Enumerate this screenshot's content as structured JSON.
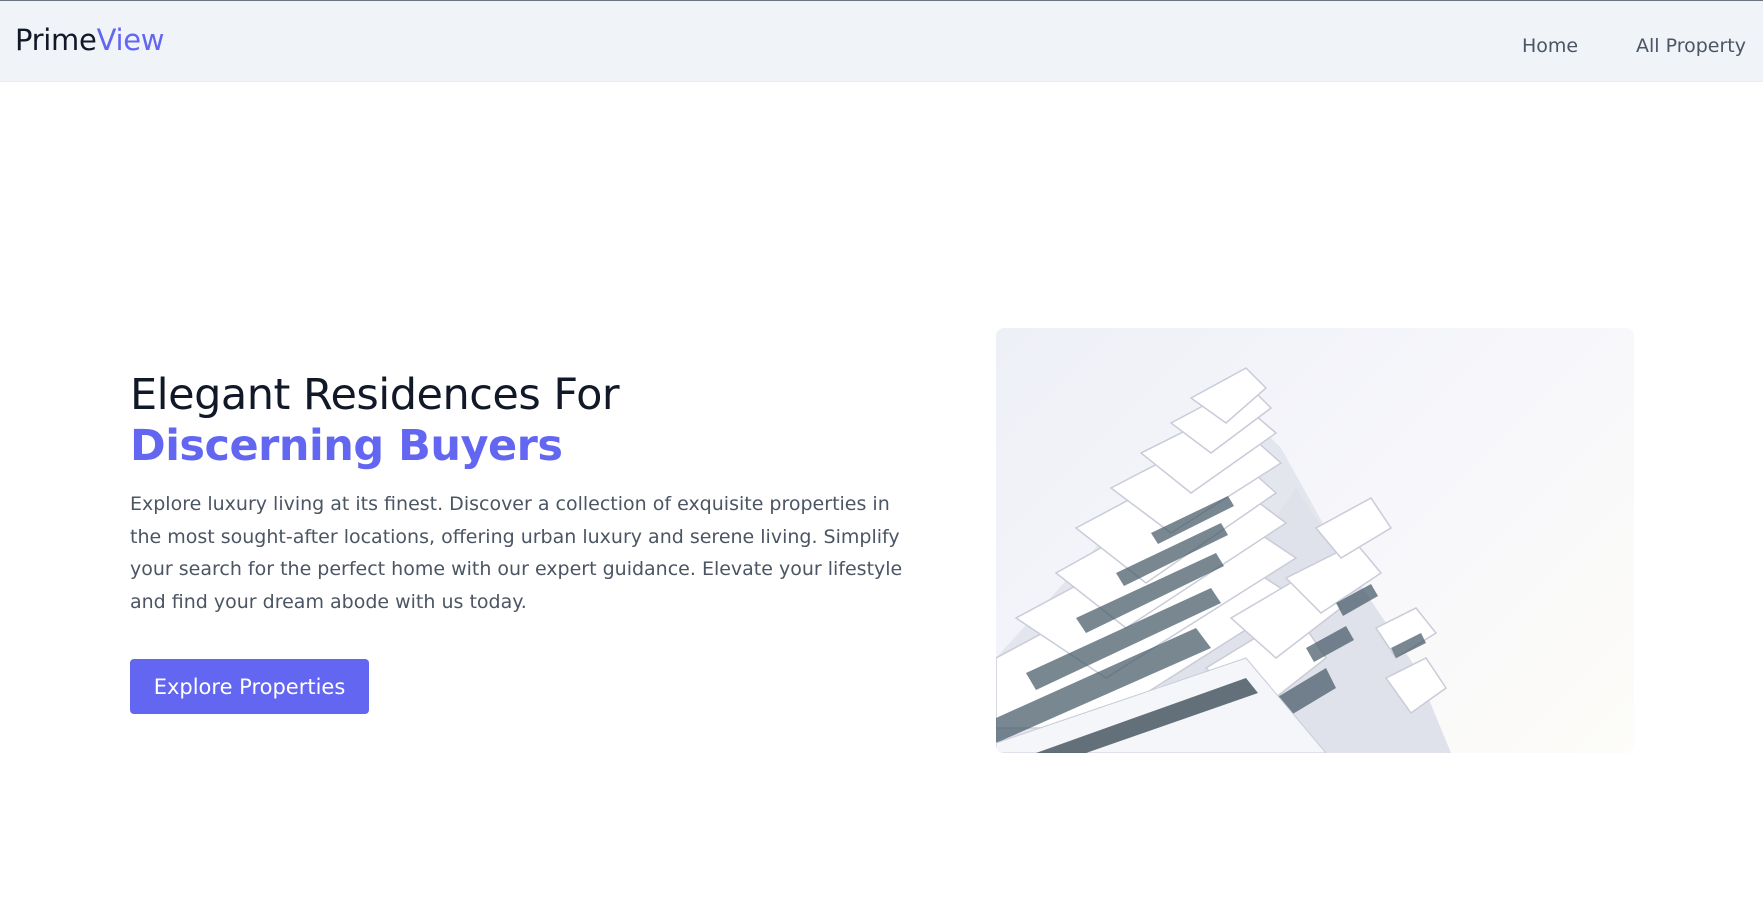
{
  "brand": {
    "name_part1": "Prime",
    "name_part2": "View",
    "accent_color": "#6366f1"
  },
  "nav": {
    "items": [
      {
        "label": "Home"
      },
      {
        "label": "All Property"
      }
    ]
  },
  "hero": {
    "headline_line1": "Elegant Residences For",
    "headline_line2": "Discerning Buyers",
    "description": "Explore luxury living at its finest. Discover a collection of exquisite properties in the most sought-after locations, offering urban luxury and serene living. Simplify your search for the perfect home with our expert guidance. Elevate your lifestyle and find your dream abode with us today.",
    "cta_label": "Explore Properties",
    "image_subject": "modern-white-apartment-building"
  },
  "colors": {
    "header_bg": "#f0f3f8",
    "text_dark": "#111827",
    "text_muted": "#4b5563",
    "button_bg": "#6366f1"
  }
}
